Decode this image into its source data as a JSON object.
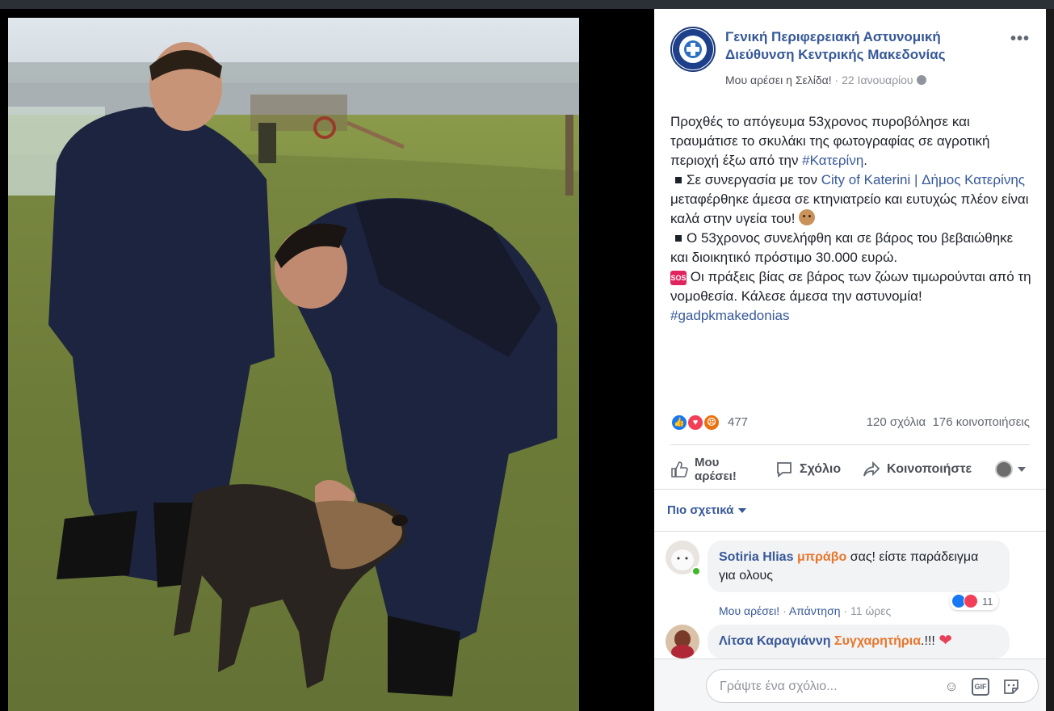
{
  "post": {
    "page_name": "Γενική Περιφερειακή Αστυνομική Διεύθυνση Κεντρικής Μακεδονίας",
    "like_page": "Μου αρέσει η Σελίδα!",
    "date": "22 Ιανουαρίου",
    "separator": " · ",
    "more": "•••",
    "text_line1": "Προχθές το απόγευμα 53χρονος πυροβόλησε και τραυμάτισε το σκυλάκι της φωτογραφίας σε αγροτική περιοχή έξω από την ",
    "hashtag1": "#Κατερίνη",
    "text_line1_end": ".",
    "bullet1_pre": "Σε συνεργασία με τον ",
    "bullet1_link": "City of Katerini | Δήμος Κατερίνης",
    "bullet1_post": " μεταφέρθηκε άμεσα σε κτηνιατρείο και ευτυχώς πλέον είναι καλά στην υγεία του! ",
    "bullet2": "Ο 53χρονος συνελήφθη και σε βάρος του βεβαιώθηκε και διοικητικό πρόστιμο 30.000 ευρώ.",
    "sos_label": "SOS",
    "sos_text": " Οι πράξεις βίας σε βάρος των ζώων τιμωρούνται από τη νομοθεσία. Κάλεσε άμεσα την αστυνομία!",
    "hashtag2": "#gadpkmakedonias"
  },
  "stats": {
    "reactions_count": "477",
    "comments": "120 σχόλια",
    "shares": "176 κοινοποιήσεις",
    "reaction_types": [
      "like-icon",
      "love-icon",
      "angry-icon"
    ]
  },
  "actions": {
    "like": "Μου αρέσει!",
    "comment": "Σχόλιο",
    "share": "Κοινοποιήστε"
  },
  "comments": {
    "sort_label": "Πιο σχετικά",
    "items": [
      {
        "author": "Sotiria Hlias",
        "highlight": "μπράβο",
        "text": " σας! είστε παράδειγμα για ολους",
        "like": "Μου αρέσει!",
        "reply": "Απάντηση",
        "time": "11 ώρες",
        "reactions": "11"
      },
      {
        "author": "Λίτσα Καραγιάννη",
        "highlight": "Συγχαρητήρια",
        "text": ".!!!"
      }
    ]
  },
  "composer": {
    "placeholder": "Γράψτε ένα σχόλιο..."
  },
  "colors": {
    "link": "#365899",
    "accent_orange": "#e8762c",
    "like_blue": "#1877f2",
    "love_red": "#f33e58"
  }
}
